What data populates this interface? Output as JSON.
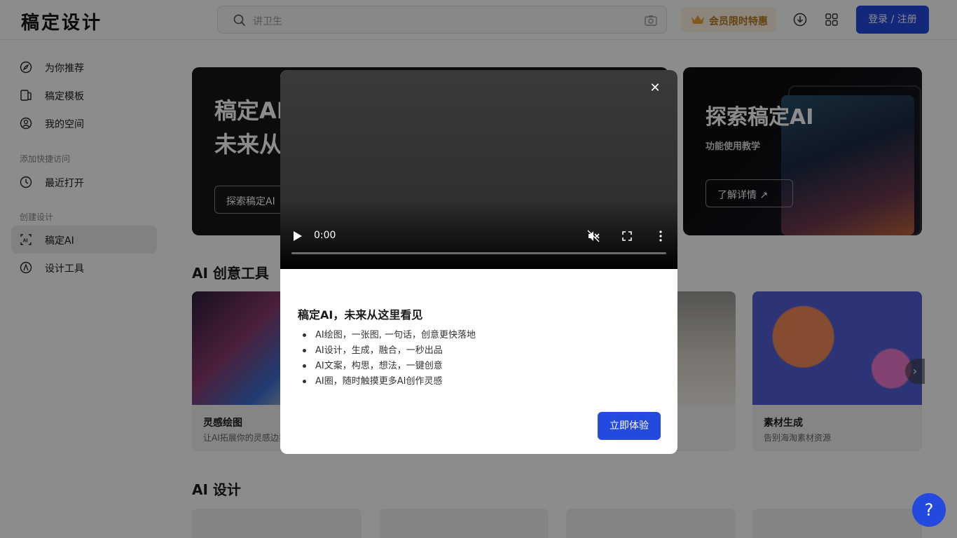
{
  "header": {
    "logo": "稿定设计",
    "search_placeholder": "讲卫生",
    "vip_label": "会员限时特惠",
    "login_label": "登录 / 注册"
  },
  "sidebar": {
    "items_top": [
      {
        "label": "为你推荐",
        "icon": "compass-icon"
      },
      {
        "label": "稿定模板",
        "icon": "template-icon"
      },
      {
        "label": "我的空间",
        "icon": "user-icon"
      }
    ],
    "section_quick": "添加快捷访问",
    "recent": {
      "label": "最近打开",
      "icon": "clock-icon"
    },
    "section_create": "创建设计",
    "items_create": [
      {
        "label": "稿定AI",
        "icon": "ai-icon",
        "active": true
      },
      {
        "label": "设计工具",
        "icon": "pen-tool-icon"
      }
    ]
  },
  "main": {
    "banner1": {
      "title": "稿定AI\n未来从",
      "button": "探索稿定AI"
    },
    "banner2": {
      "title": "探索稿定AI",
      "subtitle": "功能使用教学",
      "button": "了解详情 ↗"
    },
    "section1_title": "AI 创意工具",
    "cards": [
      {
        "title": "灵感绘图",
        "subtitle": "让AI拓展你的灵感边界"
      },
      {
        "title": "",
        "subtitle": ""
      },
      {
        "title": "",
        "subtitle": ""
      },
      {
        "title": "素材生成",
        "subtitle": "告别海淘素材资源"
      }
    ],
    "section2_title": "AI 设计"
  },
  "modal": {
    "video_time": "0:00",
    "title": "稿定AI，未来从这里看见",
    "features": [
      "AI绘图，一张图, 一句话，创意更快落地",
      "AI设计，生成，融合，一秒出品",
      "AI文案，构思，想法，一键创意",
      "AI圈，随时触摸更多AI创作灵感"
    ],
    "cta": "立即体验"
  },
  "help_label": "?",
  "colors": {
    "brand": "#2349df",
    "vip_text": "#b57a1e",
    "vip_bg": "#fdf3e3"
  }
}
